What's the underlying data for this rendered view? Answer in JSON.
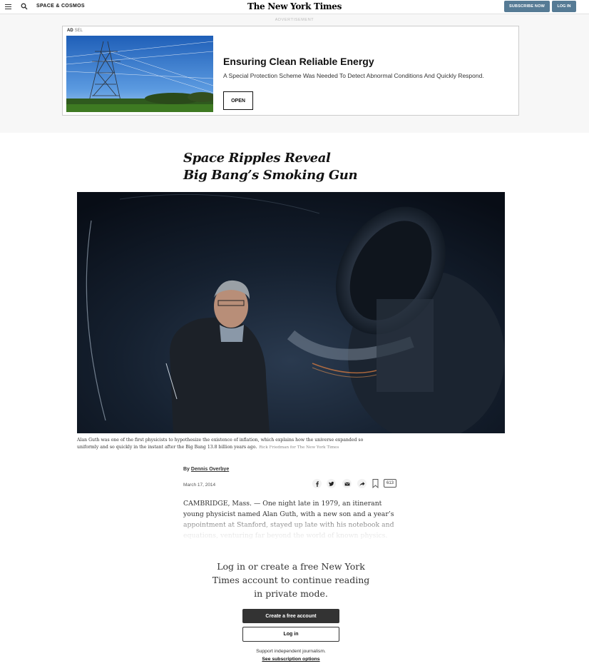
{
  "header": {
    "section": "SPACE & COSMOS",
    "masthead": "The New York Times",
    "subscribe_label": "SUBSCRIBE NOW",
    "login_label": "LOG IN",
    "menu_icon": "hamburger-icon",
    "search_icon": "search-icon"
  },
  "ad": {
    "label": "ADVERTISEMENT",
    "tag": "AD",
    "tag_brand": "SEL",
    "title": "Ensuring Clean Reliable Energy",
    "description": "A Special Protection Scheme Was Needed To Detect Abnormal Conditions And Quickly Respond.",
    "cta": "OPEN"
  },
  "article": {
    "headline_line1": "Space Ripples Reveal",
    "headline_line2": "Big Bang’s Smoking Gun",
    "caption": "Alan Guth was one of the first physicists to hypothesize the existence of inflation, which explains how the universe expanded so uniformly and so quickly in the instant after the Big Bang 13.8 billion years ago.",
    "credit": "Rick Friedman for The New York Times",
    "byline_prefix": "By",
    "author": "Dennis Overbye",
    "date": "March 17, 2014",
    "comment_count": "613",
    "body": "CAMBRIDGE, Mass. — One night late in 1979, an itinerant young physicist named Alan Guth, with a new son and a year’s appointment at Stanford, stayed up late with his notebook and equations, venturing far beyond the world of known physics."
  },
  "paywall": {
    "message": "Log in or create a free New York Times account to continue reading in private mode.",
    "create_label": "Create a free account",
    "login_label": "Log in",
    "support_text": "Support independent journalism.",
    "subscription_link": "See subscription options"
  },
  "colors": {
    "header_button": "#567b95",
    "dark_button": "#333333"
  }
}
